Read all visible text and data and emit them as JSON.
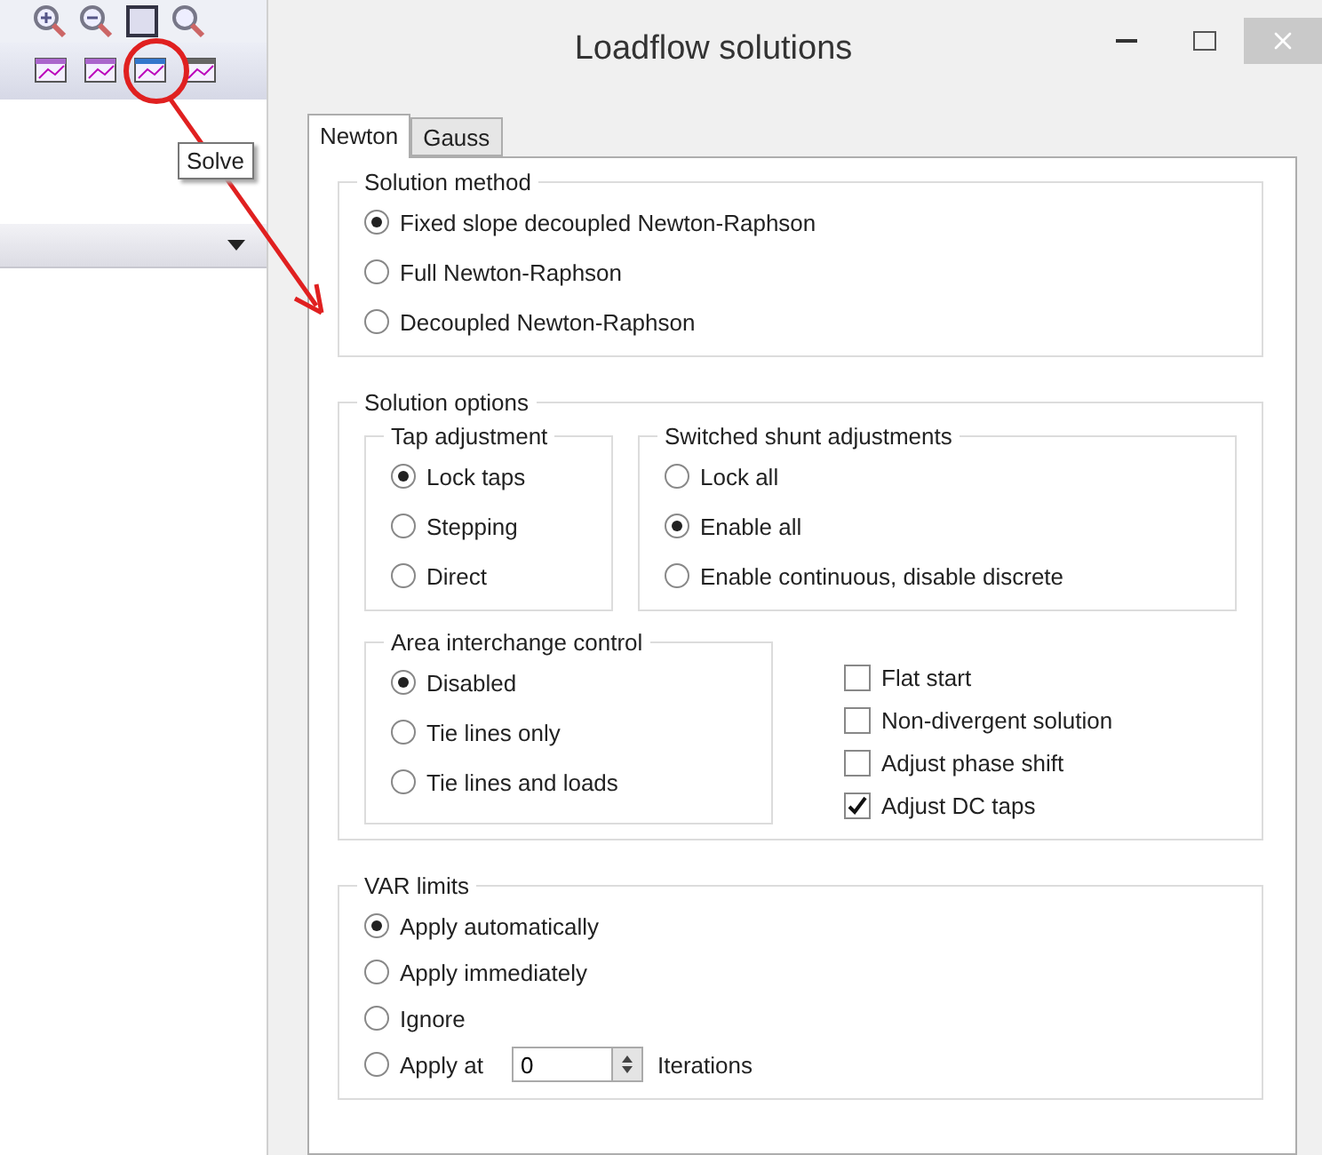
{
  "window": {
    "title": "Loadflow solutions"
  },
  "tooltip": "Solve",
  "tabs": [
    {
      "label": "Newton",
      "selected": true
    },
    {
      "label": "Gauss",
      "selected": false
    }
  ],
  "solution_method": {
    "title": "Solution method",
    "options": [
      {
        "label": "Fixed slope decoupled Newton-Raphson",
        "selected": true
      },
      {
        "label": "Full Newton-Raphson",
        "selected": false
      },
      {
        "label": "Decoupled Newton-Raphson",
        "selected": false
      }
    ]
  },
  "solution_options": {
    "title": "Solution options",
    "tap_adjustment": {
      "title": "Tap adjustment",
      "options": [
        {
          "label": "Lock taps",
          "selected": true
        },
        {
          "label": "Stepping",
          "selected": false
        },
        {
          "label": "Direct",
          "selected": false
        }
      ]
    },
    "switched_shunt_adjustments": {
      "title": "Switched shunt adjustments",
      "options": [
        {
          "label": "Lock all",
          "selected": false
        },
        {
          "label": "Enable all",
          "selected": true
        },
        {
          "label": "Enable continuous, disable discrete",
          "selected": false
        }
      ]
    },
    "area_interchange_control": {
      "title": "Area interchange control",
      "options": [
        {
          "label": "Disabled",
          "selected": true
        },
        {
          "label": "Tie lines only",
          "selected": false
        },
        {
          "label": "Tie lines and loads",
          "selected": false
        }
      ]
    },
    "checkboxes": [
      {
        "label": "Flat start",
        "checked": false
      },
      {
        "label": "Non-divergent solution",
        "checked": false
      },
      {
        "label": "Adjust phase shift",
        "checked": false
      },
      {
        "label": "Adjust DC taps",
        "checked": true
      }
    ]
  },
  "var_limits": {
    "title": "VAR limits",
    "options": [
      {
        "kind": "plain",
        "label": "Apply automatically",
        "selected": true
      },
      {
        "kind": "plain",
        "label": "Apply immediately",
        "selected": false
      },
      {
        "kind": "plain",
        "label": "Ignore",
        "selected": false
      },
      {
        "kind": "iterations",
        "label": "Apply at",
        "value": "0",
        "suffix": "Iterations",
        "selected": false
      }
    ]
  }
}
